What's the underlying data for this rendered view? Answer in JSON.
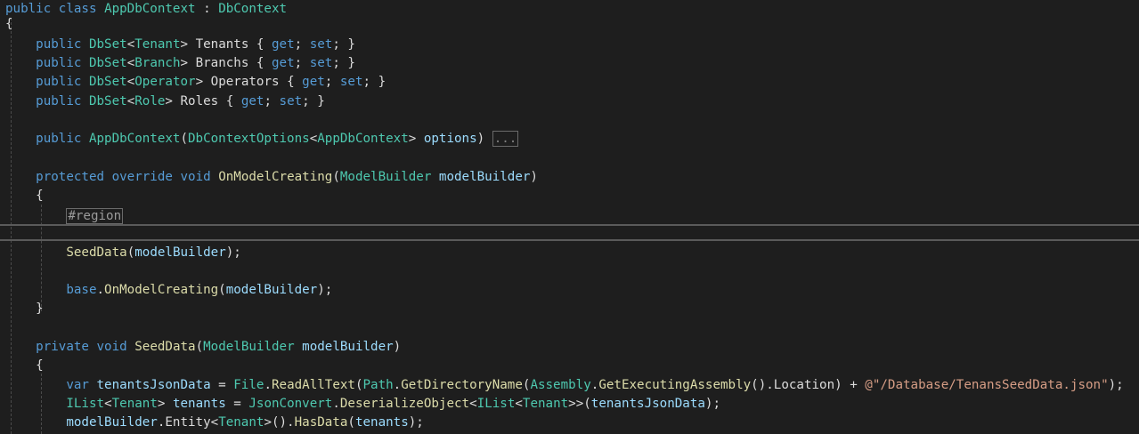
{
  "code": {
    "lines": [
      [
        {
          "t": "public",
          "c": "kw"
        },
        {
          "t": " ",
          "c": "plain"
        },
        {
          "t": "class",
          "c": "kw"
        },
        {
          "t": " ",
          "c": "plain"
        },
        {
          "t": "AppDbContext",
          "c": "type"
        },
        {
          "t": " : ",
          "c": "plain"
        },
        {
          "t": "DbContext",
          "c": "type"
        }
      ],
      [
        {
          "t": "{",
          "c": "plain"
        }
      ],
      [
        {
          "t": "    public",
          "c": "kw"
        },
        {
          "t": " ",
          "c": "plain"
        },
        {
          "t": "DbSet",
          "c": "type"
        },
        {
          "t": "<",
          "c": "plain"
        },
        {
          "t": "Tenant",
          "c": "type"
        },
        {
          "t": "> Tenants { ",
          "c": "plain"
        },
        {
          "t": "get",
          "c": "kw"
        },
        {
          "t": "; ",
          "c": "plain"
        },
        {
          "t": "set",
          "c": "kw"
        },
        {
          "t": "; }",
          "c": "plain"
        }
      ],
      [
        {
          "t": "    public",
          "c": "kw"
        },
        {
          "t": " ",
          "c": "plain"
        },
        {
          "t": "DbSet",
          "c": "type"
        },
        {
          "t": "<",
          "c": "plain"
        },
        {
          "t": "Branch",
          "c": "type"
        },
        {
          "t": "> Branchs { ",
          "c": "plain"
        },
        {
          "t": "get",
          "c": "kw"
        },
        {
          "t": "; ",
          "c": "plain"
        },
        {
          "t": "set",
          "c": "kw"
        },
        {
          "t": "; }",
          "c": "plain"
        }
      ],
      [
        {
          "t": "    public",
          "c": "kw"
        },
        {
          "t": " ",
          "c": "plain"
        },
        {
          "t": "DbSet",
          "c": "type"
        },
        {
          "t": "<",
          "c": "plain"
        },
        {
          "t": "Operator",
          "c": "type"
        },
        {
          "t": "> Operators { ",
          "c": "plain"
        },
        {
          "t": "get",
          "c": "kw"
        },
        {
          "t": "; ",
          "c": "plain"
        },
        {
          "t": "set",
          "c": "kw"
        },
        {
          "t": "; }",
          "c": "plain"
        }
      ],
      [
        {
          "t": "    public",
          "c": "kw"
        },
        {
          "t": " ",
          "c": "plain"
        },
        {
          "t": "DbSet",
          "c": "type"
        },
        {
          "t": "<",
          "c": "plain"
        },
        {
          "t": "Role",
          "c": "type"
        },
        {
          "t": "> Roles { ",
          "c": "plain"
        },
        {
          "t": "get",
          "c": "kw"
        },
        {
          "t": "; ",
          "c": "plain"
        },
        {
          "t": "set",
          "c": "kw"
        },
        {
          "t": "; }",
          "c": "plain"
        }
      ],
      [],
      [
        {
          "t": "    public",
          "c": "kw"
        },
        {
          "t": " ",
          "c": "plain"
        },
        {
          "t": "AppDbContext",
          "c": "type"
        },
        {
          "t": "(",
          "c": "plain"
        },
        {
          "t": "DbContextOptions",
          "c": "type"
        },
        {
          "t": "<",
          "c": "plain"
        },
        {
          "t": "AppDbContext",
          "c": "type"
        },
        {
          "t": "> ",
          "c": "plain"
        },
        {
          "t": "options",
          "c": "param"
        },
        {
          "t": ") ",
          "c": "plain"
        },
        {
          "t": "...",
          "c": "box"
        }
      ],
      [],
      [
        {
          "t": "    protected",
          "c": "kw"
        },
        {
          "t": " ",
          "c": "plain"
        },
        {
          "t": "override",
          "c": "kw"
        },
        {
          "t": " ",
          "c": "plain"
        },
        {
          "t": "void",
          "c": "kw"
        },
        {
          "t": " ",
          "c": "plain"
        },
        {
          "t": "OnModelCreating",
          "c": "method"
        },
        {
          "t": "(",
          "c": "plain"
        },
        {
          "t": "ModelBuilder",
          "c": "type"
        },
        {
          "t": " ",
          "c": "plain"
        },
        {
          "t": "modelBuilder",
          "c": "param"
        },
        {
          "t": ")",
          "c": "plain"
        }
      ],
      [
        {
          "t": "    {",
          "c": "plain"
        }
      ],
      [
        {
          "t": "        ",
          "c": "plain"
        },
        {
          "t": "#region",
          "c": "region"
        }
      ],
      [],
      [
        {
          "t": "        ",
          "c": "plain"
        },
        {
          "t": "SeedData",
          "c": "method"
        },
        {
          "t": "(",
          "c": "plain"
        },
        {
          "t": "modelBuilder",
          "c": "param"
        },
        {
          "t": ");",
          "c": "plain"
        }
      ],
      [],
      [
        {
          "t": "        base",
          "c": "kw"
        },
        {
          "t": ".",
          "c": "plain"
        },
        {
          "t": "OnModelCreating",
          "c": "method"
        },
        {
          "t": "(",
          "c": "plain"
        },
        {
          "t": "modelBuilder",
          "c": "param"
        },
        {
          "t": ");",
          "c": "plain"
        }
      ],
      [
        {
          "t": "    }",
          "c": "plain"
        }
      ],
      [],
      [
        {
          "t": "    private",
          "c": "kw"
        },
        {
          "t": " ",
          "c": "plain"
        },
        {
          "t": "void",
          "c": "kw"
        },
        {
          "t": " ",
          "c": "plain"
        },
        {
          "t": "SeedData",
          "c": "method"
        },
        {
          "t": "(",
          "c": "plain"
        },
        {
          "t": "ModelBuilder",
          "c": "type"
        },
        {
          "t": " ",
          "c": "plain"
        },
        {
          "t": "modelBuilder",
          "c": "param"
        },
        {
          "t": ")",
          "c": "plain"
        }
      ],
      [
        {
          "t": "    {",
          "c": "plain"
        }
      ],
      [
        {
          "t": "        var",
          "c": "kw"
        },
        {
          "t": " ",
          "c": "plain"
        },
        {
          "t": "tenantsJsonData",
          "c": "param"
        },
        {
          "t": " = ",
          "c": "plain"
        },
        {
          "t": "File",
          "c": "type"
        },
        {
          "t": ".",
          "c": "plain"
        },
        {
          "t": "ReadAllText",
          "c": "method"
        },
        {
          "t": "(",
          "c": "plain"
        },
        {
          "t": "Path",
          "c": "type"
        },
        {
          "t": ".",
          "c": "plain"
        },
        {
          "t": "GetDirectoryName",
          "c": "method"
        },
        {
          "t": "(",
          "c": "plain"
        },
        {
          "t": "Assembly",
          "c": "type"
        },
        {
          "t": ".",
          "c": "plain"
        },
        {
          "t": "GetExecutingAssembly",
          "c": "method"
        },
        {
          "t": "().Location) + ",
          "c": "plain"
        },
        {
          "t": "@\"/Database/TenansSeedData.json\"",
          "c": "str"
        },
        {
          "t": ");",
          "c": "plain"
        }
      ],
      [
        {
          "t": "        ",
          "c": "plain"
        },
        {
          "t": "IList",
          "c": "type"
        },
        {
          "t": "<",
          "c": "plain"
        },
        {
          "t": "Tenant",
          "c": "type"
        },
        {
          "t": "> ",
          "c": "plain"
        },
        {
          "t": "tenants",
          "c": "param"
        },
        {
          "t": " = ",
          "c": "plain"
        },
        {
          "t": "JsonConvert",
          "c": "type"
        },
        {
          "t": ".",
          "c": "plain"
        },
        {
          "t": "DeserializeObject",
          "c": "method"
        },
        {
          "t": "<",
          "c": "plain"
        },
        {
          "t": "IList",
          "c": "type"
        },
        {
          "t": "<",
          "c": "plain"
        },
        {
          "t": "Tenant",
          "c": "type"
        },
        {
          "t": ">>(",
          "c": "plain"
        },
        {
          "t": "tenantsJsonData",
          "c": "param"
        },
        {
          "t": ");",
          "c": "plain"
        }
      ],
      [
        {
          "t": "        ",
          "c": "plain"
        },
        {
          "t": "modelBuilder",
          "c": "param"
        },
        {
          "t": ".Entity<",
          "c": "plain"
        },
        {
          "t": "Tenant",
          "c": "type"
        },
        {
          "t": ">().",
          "c": "plain"
        },
        {
          "t": "HasData",
          "c": "method"
        },
        {
          "t": "(",
          "c": "plain"
        },
        {
          "t": "tenants",
          "c": "param"
        },
        {
          "t": ");",
          "c": "plain"
        }
      ]
    ]
  }
}
